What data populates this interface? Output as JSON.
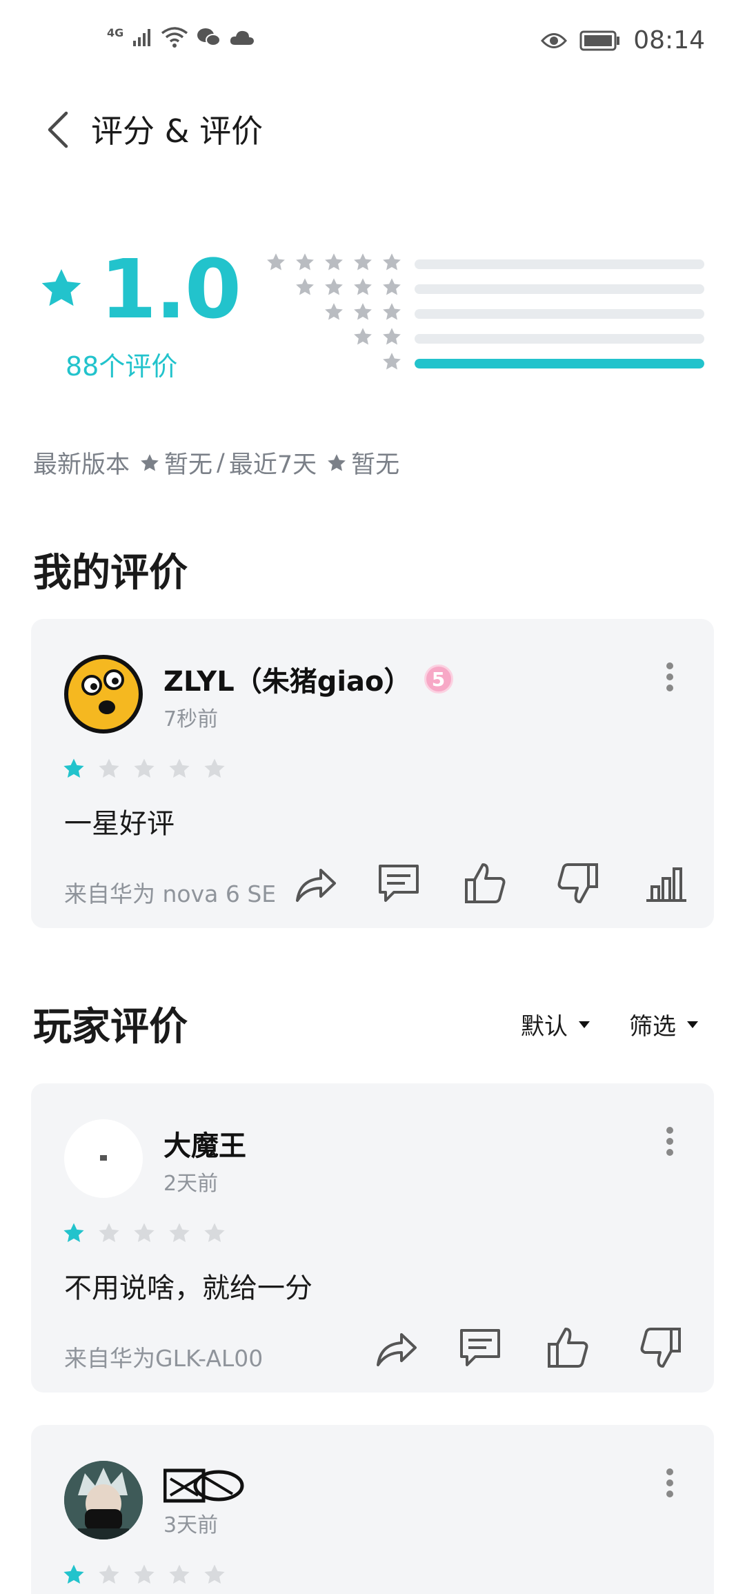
{
  "status_bar": {
    "network": "4G",
    "time": "08:14",
    "icons": [
      "signal-icon",
      "wifi-icon",
      "wechat-icon",
      "cloud-icon",
      "eye-icon",
      "battery-icon"
    ]
  },
  "header": {
    "title": "评分 & 评价"
  },
  "rating_summary": {
    "score": "1.0",
    "count_label": "88个评价",
    "distribution": [
      {
        "stars": 5,
        "fraction": 0.0
      },
      {
        "stars": 4,
        "fraction": 0.0
      },
      {
        "stars": 3,
        "fraction": 0.0
      },
      {
        "stars": 2,
        "fraction": 0.0
      },
      {
        "stars": 1,
        "fraction": 1.0
      }
    ],
    "accent_color": "#22c3cc"
  },
  "version_line": {
    "latest_label": "最新版本",
    "latest_value": "暂无",
    "separator": "/",
    "recent_label": "最近7天",
    "recent_value": "暂无"
  },
  "my_review": {
    "section_title": "我的评价",
    "username": "ZLYL（朱猪giao）",
    "level_badge": "5",
    "time_ago": "7秒前",
    "rating": 1,
    "comment": "一星好评",
    "device": "来自华为 nova 6 SE"
  },
  "player_reviews": {
    "section_title": "玩家评价",
    "sort_label": "默认",
    "filter_label": "筛选",
    "items": [
      {
        "username": "大魔王",
        "time_ago": "2天前",
        "rating": 1,
        "comment": "不用说啥，就给一分",
        "device": "来自华为GLK-AL00"
      },
      {
        "username": "",
        "time_ago": "3天前",
        "rating": 1
      }
    ]
  }
}
